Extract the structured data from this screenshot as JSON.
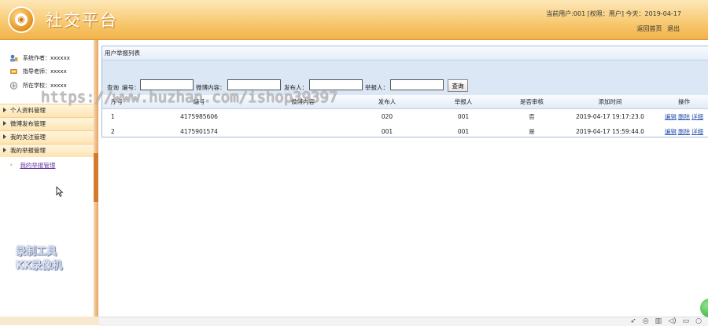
{
  "header": {
    "title": "社交平台",
    "user_info": "当前用户:001 [权限：用户] 今天：2019-04-17",
    "back_home": "返回首页",
    "logout": "退出"
  },
  "sidebar": {
    "info": [
      {
        "label": "系统作者：xxxxxx",
        "icon": "person-icon"
      },
      {
        "label": "指导老师：xxxxx",
        "icon": "teacher-icon"
      },
      {
        "label": "所在学校：xxxxx",
        "icon": "school-icon"
      }
    ],
    "menus": [
      {
        "label": "个人资料管理"
      },
      {
        "label": "微博发布管理"
      },
      {
        "label": "我的关注管理"
      },
      {
        "label": "我的举报管理"
      }
    ],
    "submenu": "我的举报管理"
  },
  "panel": {
    "title": "用户举报列表",
    "search": {
      "prefix": "查询",
      "id_label": "编号：",
      "content_label": "微博内容：",
      "publisher_label": "发布人：",
      "reporter_label": "举报人：",
      "button": "查询"
    },
    "columns": [
      "序号",
      "编号",
      "微博内容",
      "发布人",
      "举报人",
      "是否审核",
      "添加时间",
      "操作"
    ],
    "rows": [
      {
        "seq": "1",
        "id": "4175985606",
        "content": "",
        "publisher": "020",
        "reporter": "001",
        "reviewed": "否",
        "time": "2019-04-17 19:17:23.0"
      },
      {
        "seq": "2",
        "id": "4175901574",
        "content": "",
        "publisher": "001",
        "reporter": "001",
        "reviewed": "是",
        "time": "2019-04-17 15:59:44.0"
      }
    ],
    "ops": {
      "edit": "编辑",
      "delete": "删除",
      "detail": "详细"
    }
  },
  "watermarks": {
    "url": "https://www.huzhan.com/ishop39397",
    "recorder_line1": "录制工具",
    "recorder_line2": "KK录像机"
  }
}
